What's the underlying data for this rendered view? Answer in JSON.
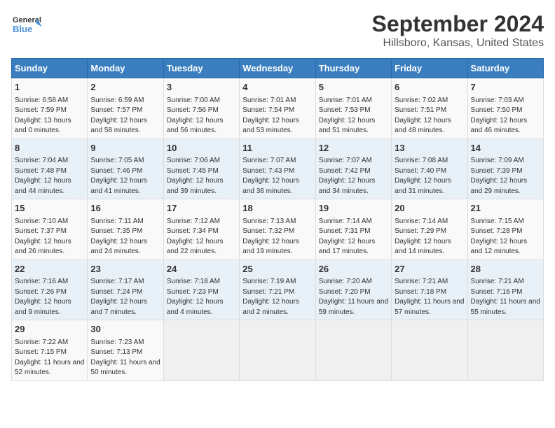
{
  "logo": {
    "line1": "General",
    "line2": "Blue"
  },
  "title": "September 2024",
  "subtitle": "Hillsboro, Kansas, United States",
  "days_of_week": [
    "Sunday",
    "Monday",
    "Tuesday",
    "Wednesday",
    "Thursday",
    "Friday",
    "Saturday"
  ],
  "weeks": [
    [
      {
        "day": 1,
        "sunrise": "6:58 AM",
        "sunset": "7:59 PM",
        "daylight": "13 hours and 0 minutes."
      },
      {
        "day": 2,
        "sunrise": "6:59 AM",
        "sunset": "7:57 PM",
        "daylight": "12 hours and 58 minutes."
      },
      {
        "day": 3,
        "sunrise": "7:00 AM",
        "sunset": "7:56 PM",
        "daylight": "12 hours and 56 minutes."
      },
      {
        "day": 4,
        "sunrise": "7:01 AM",
        "sunset": "7:54 PM",
        "daylight": "12 hours and 53 minutes."
      },
      {
        "day": 5,
        "sunrise": "7:01 AM",
        "sunset": "7:53 PM",
        "daylight": "12 hours and 51 minutes."
      },
      {
        "day": 6,
        "sunrise": "7:02 AM",
        "sunset": "7:51 PM",
        "daylight": "12 hours and 48 minutes."
      },
      {
        "day": 7,
        "sunrise": "7:03 AM",
        "sunset": "7:50 PM",
        "daylight": "12 hours and 46 minutes."
      }
    ],
    [
      {
        "day": 8,
        "sunrise": "7:04 AM",
        "sunset": "7:48 PM",
        "daylight": "12 hours and 44 minutes."
      },
      {
        "day": 9,
        "sunrise": "7:05 AM",
        "sunset": "7:46 PM",
        "daylight": "12 hours and 41 minutes."
      },
      {
        "day": 10,
        "sunrise": "7:06 AM",
        "sunset": "7:45 PM",
        "daylight": "12 hours and 39 minutes."
      },
      {
        "day": 11,
        "sunrise": "7:07 AM",
        "sunset": "7:43 PM",
        "daylight": "12 hours and 36 minutes."
      },
      {
        "day": 12,
        "sunrise": "7:07 AM",
        "sunset": "7:42 PM",
        "daylight": "12 hours and 34 minutes."
      },
      {
        "day": 13,
        "sunrise": "7:08 AM",
        "sunset": "7:40 PM",
        "daylight": "12 hours and 31 minutes."
      },
      {
        "day": 14,
        "sunrise": "7:09 AM",
        "sunset": "7:39 PM",
        "daylight": "12 hours and 29 minutes."
      }
    ],
    [
      {
        "day": 15,
        "sunrise": "7:10 AM",
        "sunset": "7:37 PM",
        "daylight": "12 hours and 26 minutes."
      },
      {
        "day": 16,
        "sunrise": "7:11 AM",
        "sunset": "7:35 PM",
        "daylight": "12 hours and 24 minutes."
      },
      {
        "day": 17,
        "sunrise": "7:12 AM",
        "sunset": "7:34 PM",
        "daylight": "12 hours and 22 minutes."
      },
      {
        "day": 18,
        "sunrise": "7:13 AM",
        "sunset": "7:32 PM",
        "daylight": "12 hours and 19 minutes."
      },
      {
        "day": 19,
        "sunrise": "7:14 AM",
        "sunset": "7:31 PM",
        "daylight": "12 hours and 17 minutes."
      },
      {
        "day": 20,
        "sunrise": "7:14 AM",
        "sunset": "7:29 PM",
        "daylight": "12 hours and 14 minutes."
      },
      {
        "day": 21,
        "sunrise": "7:15 AM",
        "sunset": "7:28 PM",
        "daylight": "12 hours and 12 minutes."
      }
    ],
    [
      {
        "day": 22,
        "sunrise": "7:16 AM",
        "sunset": "7:26 PM",
        "daylight": "12 hours and 9 minutes."
      },
      {
        "day": 23,
        "sunrise": "7:17 AM",
        "sunset": "7:24 PM",
        "daylight": "12 hours and 7 minutes."
      },
      {
        "day": 24,
        "sunrise": "7:18 AM",
        "sunset": "7:23 PM",
        "daylight": "12 hours and 4 minutes."
      },
      {
        "day": 25,
        "sunrise": "7:19 AM",
        "sunset": "7:21 PM",
        "daylight": "12 hours and 2 minutes."
      },
      {
        "day": 26,
        "sunrise": "7:20 AM",
        "sunset": "7:20 PM",
        "daylight": "11 hours and 59 minutes."
      },
      {
        "day": 27,
        "sunrise": "7:21 AM",
        "sunset": "7:18 PM",
        "daylight": "11 hours and 57 minutes."
      },
      {
        "day": 28,
        "sunrise": "7:21 AM",
        "sunset": "7:16 PM",
        "daylight": "11 hours and 55 minutes."
      }
    ],
    [
      {
        "day": 29,
        "sunrise": "7:22 AM",
        "sunset": "7:15 PM",
        "daylight": "11 hours and 52 minutes."
      },
      {
        "day": 30,
        "sunrise": "7:23 AM",
        "sunset": "7:13 PM",
        "daylight": "11 hours and 50 minutes."
      },
      null,
      null,
      null,
      null,
      null
    ]
  ]
}
